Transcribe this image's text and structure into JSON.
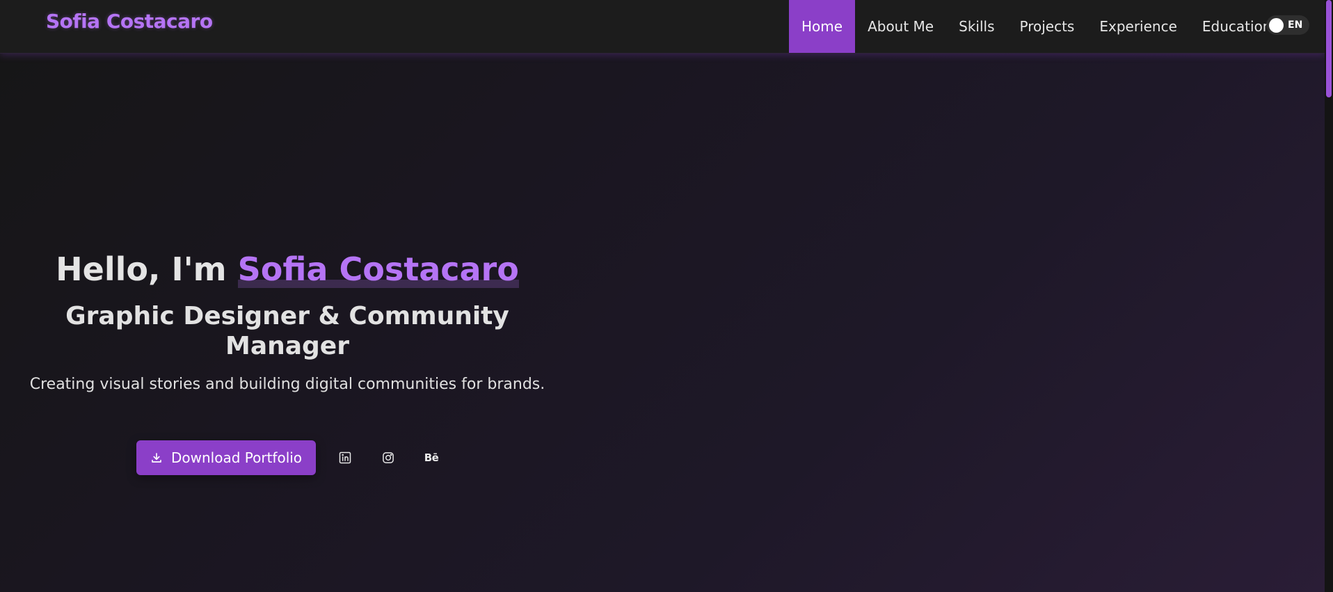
{
  "brand": {
    "name": "Sofia Costacaro"
  },
  "nav": {
    "items": [
      {
        "label": "Home",
        "active": true
      },
      {
        "label": "About Me",
        "active": false
      },
      {
        "label": "Skills",
        "active": false
      },
      {
        "label": "Projects",
        "active": false
      },
      {
        "label": "Experience",
        "active": false
      },
      {
        "label": "Education",
        "active": false
      }
    ],
    "language": "EN"
  },
  "hero": {
    "greeting": "Hello, I'm",
    "name": "Sofia Costacaro",
    "role": "Graphic Designer & Community Manager",
    "tagline": "Creating visual stories and building digital communities for brands.",
    "download_label": "Download Portfolio",
    "socials": [
      {
        "icon": "linkedin-icon"
      },
      {
        "icon": "instagram-icon"
      },
      {
        "icon": "behance-icon",
        "text": "Bē"
      }
    ]
  },
  "colors": {
    "accent": "#8b3fc8",
    "brand_text": "#b574f5",
    "nav_background": "#1c1c1c",
    "page_background": "#17151a"
  }
}
